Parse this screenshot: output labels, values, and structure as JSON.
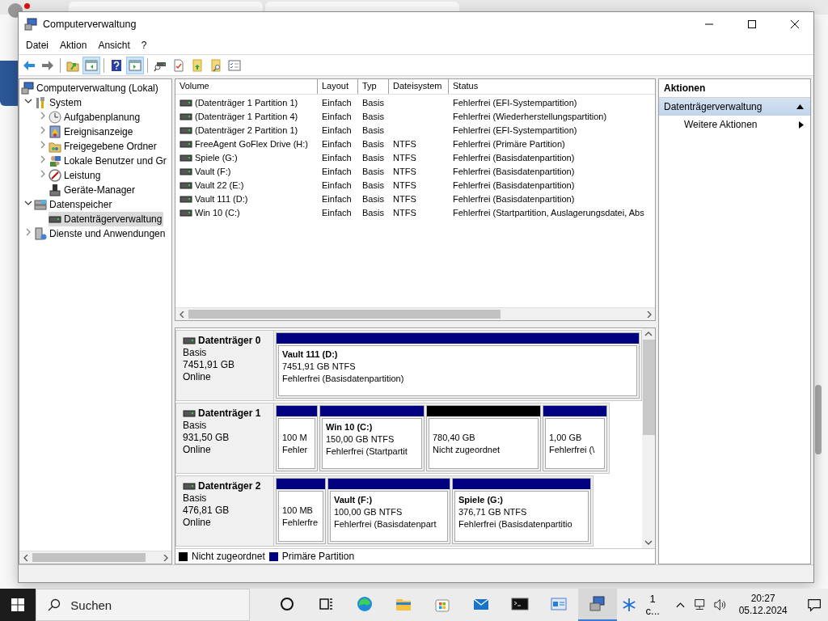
{
  "window": {
    "title": "Computerverwaltung"
  },
  "menu": [
    "Datei",
    "Aktion",
    "Ansicht",
    "?"
  ],
  "toolbar": [
    {
      "kind": "back",
      "pressed": false
    },
    {
      "kind": "forward",
      "pressed": false
    },
    {
      "kind": "separator"
    },
    {
      "kind": "up",
      "pressed": false
    },
    {
      "kind": "tree-toggle",
      "pressed": true
    },
    {
      "kind": "separator"
    },
    {
      "kind": "help",
      "pressed": false
    },
    {
      "kind": "action-toggle",
      "pressed": true
    },
    {
      "kind": "separator"
    },
    {
      "kind": "connect",
      "pressed": false
    },
    {
      "kind": "check",
      "pressed": false
    },
    {
      "kind": "folder-up",
      "pressed": false
    },
    {
      "kind": "folder-search",
      "pressed": false
    },
    {
      "kind": "checklist",
      "pressed": false
    }
  ],
  "tree": {
    "label": "Computerverwaltung (Lokal)",
    "kind": "computer",
    "selected": false,
    "children": [
      {
        "label": "System",
        "kind": "tools",
        "expanded": true,
        "selected": false,
        "children": [
          {
            "label": "Aufgabenplanung",
            "kind": "clock",
            "expanded": false,
            "selected": false
          },
          {
            "label": "Ereignisanzeige",
            "kind": "event",
            "expanded": false,
            "selected": false
          },
          {
            "label": "Freigegebene Ordner",
            "kind": "folder",
            "expanded": false,
            "selected": false
          },
          {
            "label": "Lokale Benutzer und Gr",
            "kind": "users",
            "expanded": false,
            "selected": false
          },
          {
            "label": "Leistung",
            "kind": "gauge",
            "expanded": false,
            "selected": false
          },
          {
            "label": "Geräte-Manager",
            "kind": "device",
            "selected": false
          }
        ]
      },
      {
        "label": "Datenspeicher",
        "kind": "storage",
        "expanded": true,
        "selected": false,
        "children": [
          {
            "label": "Datenträgerverwaltung",
            "kind": "disk",
            "selected": true
          }
        ]
      },
      {
        "label": "Dienste und Anwendungen",
        "kind": "services",
        "expanded": false,
        "selected": false
      }
    ]
  },
  "volumes": {
    "columns": [
      "Volume",
      "Layout",
      "Typ",
      "Dateisystem",
      "Status"
    ],
    "rows": [
      {
        "selected": false,
        "cells": [
          "(Datenträger 1 Partition 1)",
          "Einfach",
          "Basis",
          "",
          "Fehlerfrei (EFI-Systempartition)"
        ]
      },
      {
        "selected": false,
        "cells": [
          "(Datenträger 1 Partition 4)",
          "Einfach",
          "Basis",
          "",
          "Fehlerfrei (Wiederherstellungspartition)"
        ]
      },
      {
        "selected": false,
        "cells": [
          "(Datenträger 2 Partition 1)",
          "Einfach",
          "Basis",
          "",
          "Fehlerfrei (EFI-Systempartition)"
        ]
      },
      {
        "selected": false,
        "cells": [
          "FreeAgent GoFlex Drive (H:)",
          "Einfach",
          "Basis",
          "NTFS",
          "Fehlerfrei (Primäre Partition)"
        ]
      },
      {
        "selected": false,
        "cells": [
          "Spiele (G:)",
          "Einfach",
          "Basis",
          "NTFS",
          "Fehlerfrei (Basisdatenpartition)"
        ]
      },
      {
        "selected": false,
        "cells": [
          "Vault (F:)",
          "Einfach",
          "Basis",
          "NTFS",
          "Fehlerfrei (Basisdatenpartition)"
        ]
      },
      {
        "selected": false,
        "cells": [
          "Vault 22 (E:)",
          "Einfach",
          "Basis",
          "NTFS",
          "Fehlerfrei (Basisdatenpartition)"
        ]
      },
      {
        "selected": false,
        "cells": [
          "Vault 111 (D:)",
          "Einfach",
          "Basis",
          "NTFS",
          "Fehlerfrei (Basisdatenpartition)"
        ]
      },
      {
        "selected": false,
        "cells": [
          "Win 10 (C:)",
          "Einfach",
          "Basis",
          "NTFS",
          "Fehlerfrei (Startpartition, Auslagerungsdatei, Abs"
        ]
      }
    ]
  },
  "disks": [
    {
      "name": "Datenträger 0",
      "type": "Basis",
      "size": "7451,91 GB",
      "status": "Online",
      "partitions": [
        {
          "kind": "primary",
          "name": "Vault 111  (D:)",
          "size": "7451,91 GB NTFS",
          "status": "Fehlerfrei (Basisdatenpartition)"
        }
      ]
    },
    {
      "name": "Datenträger 1",
      "type": "Basis",
      "size": "931,50 GB",
      "status": "Online",
      "partitions": [
        {
          "kind": "primary",
          "size": "100 M",
          "status": "Fehler"
        },
        {
          "kind": "primary",
          "name": "Win 10  (C:)",
          "size": "150,00 GB NTFS",
          "status": "Fehlerfrei (Startpartit"
        },
        {
          "kind": "unallocated",
          "size": "780,40 GB",
          "status": "Nicht zugeordnet"
        },
        {
          "kind": "primary",
          "size": "1,00 GB",
          "status": "Fehlerfrei (\\"
        }
      ]
    },
    {
      "name": "Datenträger 2",
      "type": "Basis",
      "size": "476,81 GB",
      "status": "Online",
      "partitions": [
        {
          "kind": "primary",
          "size": "100 MB",
          "status": "Fehlerfre"
        },
        {
          "kind": "primary",
          "name": "Vault  (F:)",
          "size": "100,00 GB NTFS",
          "status": "Fehlerfrei (Basisdatenpart"
        },
        {
          "kind": "primary",
          "name": "Spiele  (G:)",
          "size": "376,71 GB NTFS",
          "status": "Fehlerfrei (Basisdatenpartitio"
        }
      ]
    }
  ],
  "legend": [
    {
      "kind": "unallocated",
      "label": "Nicht zugeordnet",
      "color": "#000000"
    },
    {
      "kind": "primary",
      "label": "Primäre Partition",
      "color": "#000080"
    }
  ],
  "actions": {
    "title": "Aktionen",
    "section": {
      "label": "Datenträgerverwaltung",
      "expanded": true
    },
    "items": [
      "Weitere Aktionen"
    ]
  },
  "taskbar": {
    "search": {
      "placeholder": "Suchen"
    },
    "apps": [
      {
        "kind": "cortana",
        "active": false
      },
      {
        "kind": "taskview",
        "active": false
      },
      {
        "kind": "edge",
        "active": false
      },
      {
        "kind": "explorer",
        "active": false
      },
      {
        "kind": "store",
        "active": false
      },
      {
        "kind": "mail",
        "active": false
      },
      {
        "kind": "terminal",
        "active": false
      },
      {
        "kind": "app",
        "active": false
      },
      {
        "kind": "compmgmt",
        "active": true
      }
    ],
    "weather": "1 c...",
    "time": "20:27",
    "date": "05.12.2024"
  }
}
